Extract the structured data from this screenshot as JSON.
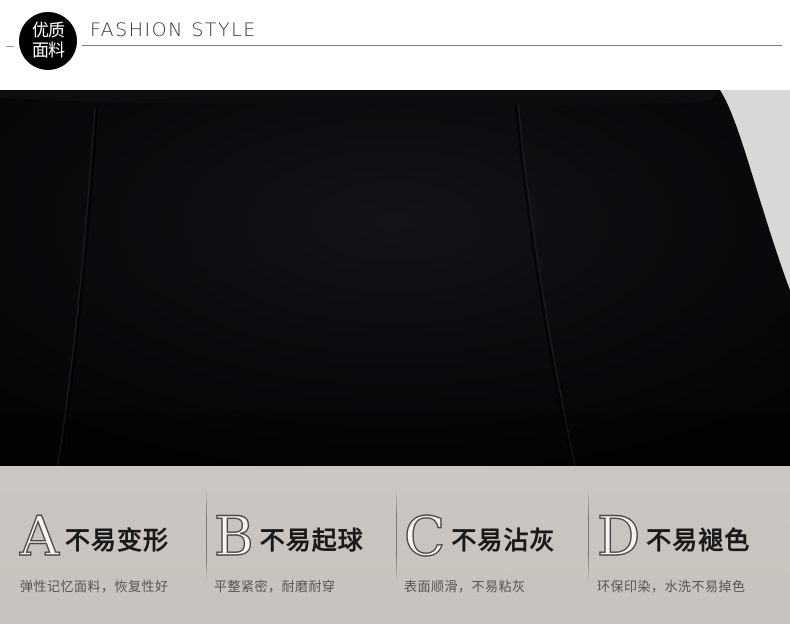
{
  "header": {
    "badge_line1": "优质",
    "badge_line2": "面料",
    "title": "FASHION STYLE"
  },
  "colors": {
    "fabric": "#06060a",
    "band": "#c9c5c0",
    "badge": "#000000"
  },
  "features": [
    {
      "letter": "A",
      "title": "不易变形",
      "desc": "弹性记忆面料，恢复性好"
    },
    {
      "letter": "B",
      "title": "不易起球",
      "desc": "平整紧密，耐磨耐穿"
    },
    {
      "letter": "C",
      "title": "不易沾灰",
      "desc": "表面顺滑，不易粘灰"
    },
    {
      "letter": "D",
      "title": "不易褪色",
      "desc": "环保印染，水洗不易掉色"
    }
  ]
}
